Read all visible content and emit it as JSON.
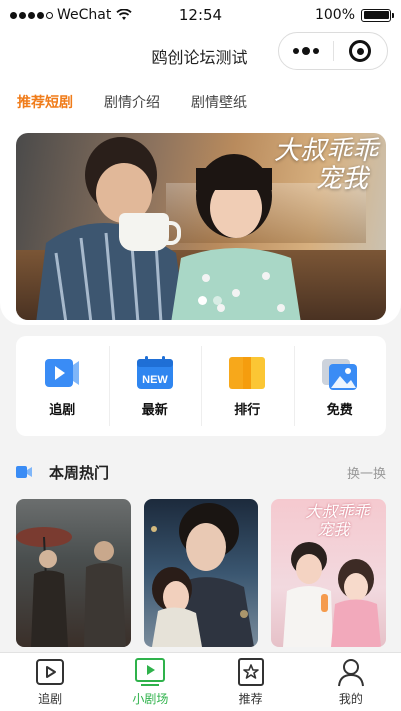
{
  "status_bar": {
    "carrier": "WeChat",
    "time": "12:54",
    "battery": "100%",
    "battery_level": 1.0
  },
  "nav": {
    "title": "鸥创论坛测试"
  },
  "top_tabs": [
    {
      "label": "推荐短剧",
      "active": true
    },
    {
      "label": "剧情介绍",
      "active": false
    },
    {
      "label": "剧情壁纸",
      "active": false
    }
  ],
  "banner": {
    "title_line1": "大叔乖乖",
    "title_line2": "宠我"
  },
  "categories": [
    {
      "label": "追剧",
      "icon": "video-play-icon"
    },
    {
      "label": "最新",
      "icon": "new-calendar-icon"
    },
    {
      "label": "排行",
      "icon": "ranking-icon"
    },
    {
      "label": "免费",
      "icon": "free-image-icon"
    }
  ],
  "section": {
    "title": "本周热门",
    "more_label": "换一换"
  },
  "posters": [
    {
      "name": "poster-1"
    },
    {
      "name": "poster-2"
    },
    {
      "name": "poster-3",
      "title_line1": "大叔乖乖",
      "title_line2": "宠我"
    }
  ],
  "tabbar": [
    {
      "label": "追剧",
      "icon": "play-box-icon",
      "active": false
    },
    {
      "label": "小剧场",
      "icon": "theater-icon",
      "active": true
    },
    {
      "label": "推荐",
      "icon": "star-icon",
      "active": false
    },
    {
      "label": "我的",
      "icon": "person-icon",
      "active": false
    }
  ],
  "colors": {
    "accent_orange": "#f07c1a",
    "active_green": "#2fb24b",
    "blue": "#3a8cf5",
    "orange_yellow": "#f7a81b"
  }
}
